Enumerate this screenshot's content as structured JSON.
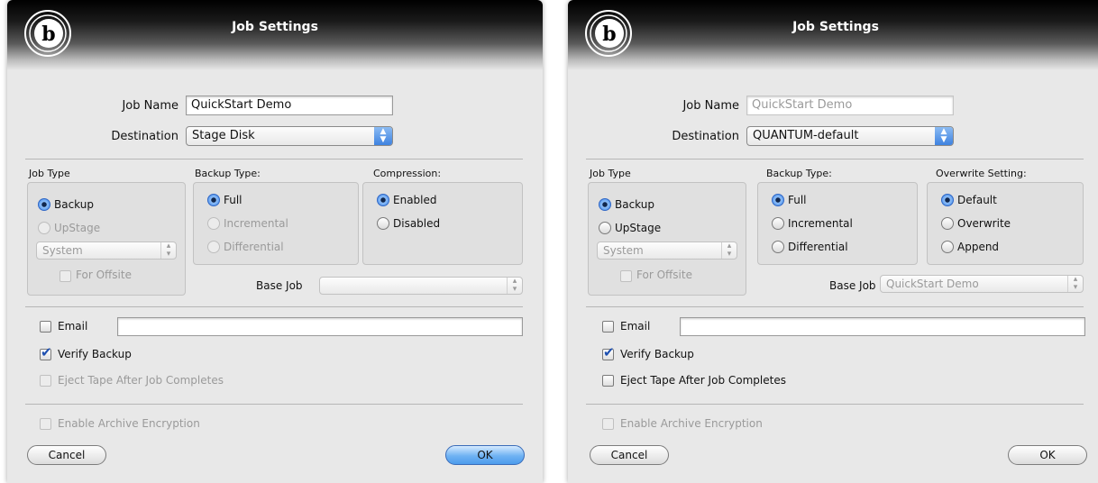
{
  "dialogs": [
    {
      "title": "Job Settings",
      "job_name_label": "Job Name",
      "job_name_value": "QuickStart Demo",
      "destination_label": "Destination",
      "destination_value": "Stage Disk",
      "job_type_label": "Job Type",
      "job_type_options": [
        "Backup",
        "UpStage"
      ],
      "job_type_selected": "Backup",
      "system_select_value": "System",
      "for_offsite_label": "For Offsite",
      "backup_type_label": "Backup Type:",
      "backup_type_options": [
        "Full",
        "Incremental",
        "Differential"
      ],
      "backup_type_selected": "Full",
      "third_group_label": "Compression:",
      "third_group_options": [
        "Enabled",
        "Disabled"
      ],
      "third_group_selected": "Enabled",
      "base_job_label": "Base Job",
      "base_job_value": "",
      "email_label": "Email",
      "email_value": "",
      "verify_backup_label": "Verify Backup",
      "verify_backup_checked": true,
      "eject_tape_label": "Eject Tape After Job Completes",
      "eject_tape_checked": false,
      "enable_encryption_label": "Enable Archive Encryption",
      "cancel_label": "Cancel",
      "ok_label": "OK"
    },
    {
      "title": "Job Settings",
      "job_name_label": "Job Name",
      "job_name_value": "QuickStart Demo",
      "destination_label": "Destination",
      "destination_value": "QUANTUM-default",
      "job_type_label": "Job Type",
      "job_type_options": [
        "Backup",
        "UpStage"
      ],
      "job_type_selected": "Backup",
      "system_select_value": "System",
      "for_offsite_label": "For Offsite",
      "backup_type_label": "Backup Type:",
      "backup_type_options": [
        "Full",
        "Incremental",
        "Differential"
      ],
      "backup_type_selected": "Full",
      "third_group_label": "Overwrite Setting:",
      "third_group_options": [
        "Default",
        "Overwrite",
        "Append"
      ],
      "third_group_selected": "Default",
      "base_job_label": "Base Job",
      "base_job_value": "QuickStart Demo",
      "email_label": "Email",
      "email_value": "",
      "verify_backup_label": "Verify Backup",
      "verify_backup_checked": true,
      "eject_tape_label": "Eject Tape After Job Completes",
      "eject_tape_checked": false,
      "enable_encryption_label": "Enable Archive Encryption",
      "cancel_label": "Cancel",
      "ok_label": "OK"
    }
  ],
  "colors": {
    "accent_blue": "#3f86e2",
    "header_black": "#000000",
    "dialog_background": "#e8e8e8"
  },
  "icons": {
    "app_logo": "b-logo-icon",
    "checkmark": "checkmark-icon",
    "popup_arrows": "updown-arrows-icon"
  }
}
